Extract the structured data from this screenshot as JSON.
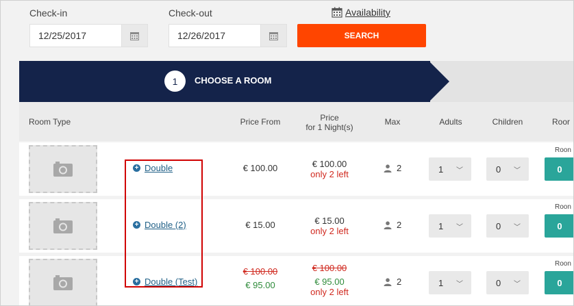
{
  "search": {
    "checkin_label": "Check-in",
    "checkin_value": "12/25/2017",
    "checkout_label": "Check-out",
    "checkout_value": "12/26/2017",
    "availability_label": "Availability",
    "search_label": "SEARCH"
  },
  "steps": {
    "active_number": "1",
    "active_label": "CHOOSE A ROOM"
  },
  "table": {
    "headers": {
      "room_type": "Room Type",
      "price_from": "Price From",
      "price_night_1": "Price",
      "price_night_2": "for 1 Night(s)",
      "max": "Max",
      "adults": "Adults",
      "children": "Children",
      "rooms": "Roor"
    },
    "rows": [
      {
        "name": "Double",
        "price_from": "€ 100.00",
        "price_from_old": "",
        "price_night": "€ 100.00",
        "price_night_old": "",
        "availability": "only 2 left",
        "max": "2",
        "adults": "1",
        "children": "0",
        "rooms_label": "Roon",
        "rooms_value": "0"
      },
      {
        "name": "Double (2)",
        "price_from": "€ 15.00",
        "price_from_old": "",
        "price_night": "€ 15.00",
        "price_night_old": "",
        "availability": "only 2 left",
        "max": "2",
        "adults": "1",
        "children": "0",
        "rooms_label": "Roon",
        "rooms_value": "0"
      },
      {
        "name": "Double (Test)",
        "price_from": "€ 95.00",
        "price_from_old": "€ 100.00",
        "price_night": "€ 95.00",
        "price_night_old": "€ 100.00",
        "availability": "only 2 left",
        "max": "2",
        "adults": "1",
        "children": "0",
        "rooms_label": "Roon",
        "rooms_value": "0"
      }
    ]
  },
  "colors": {
    "accent": "#ff4500",
    "banner": "#14234a",
    "book": "#2aa59a",
    "highlight": "#d00000"
  }
}
